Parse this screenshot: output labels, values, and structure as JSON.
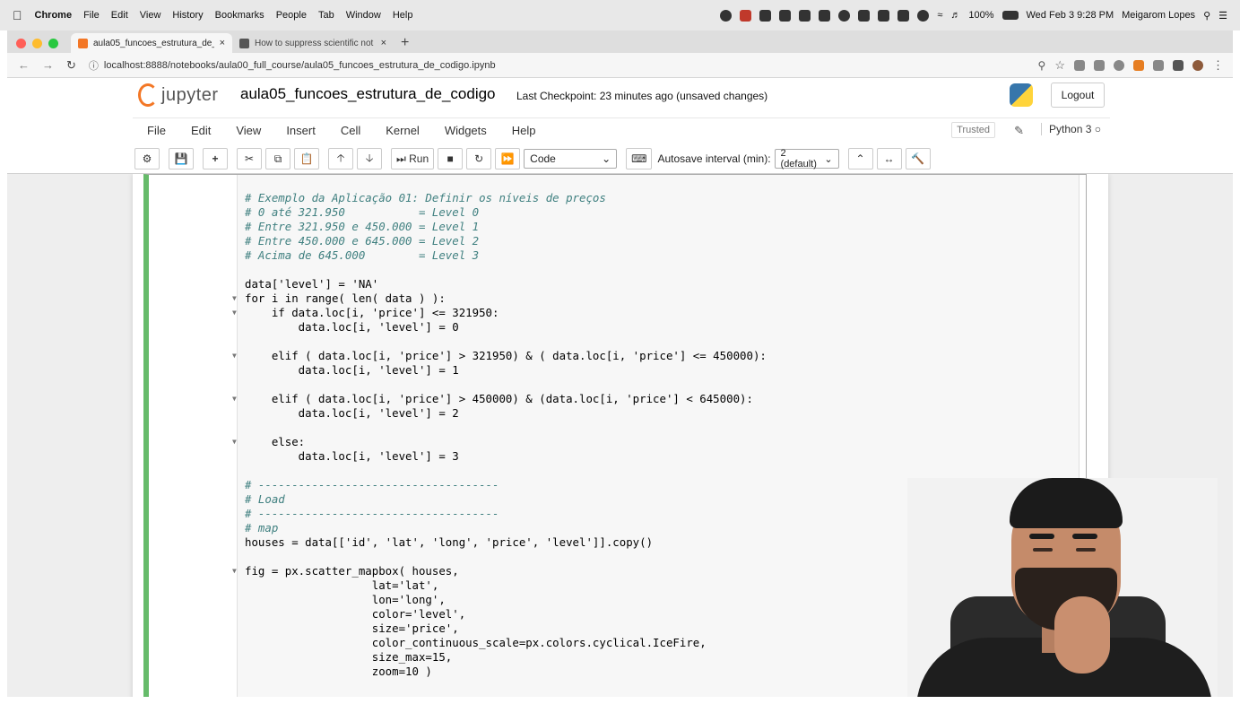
{
  "menubar": {
    "apple": "",
    "app": "Chrome",
    "items": [
      "File",
      "Edit",
      "View",
      "History",
      "Bookmarks",
      "People",
      "Tab",
      "Window",
      "Help"
    ],
    "battery": "100%",
    "datetime": "Wed Feb 3  9:28 PM",
    "user": "Meigarom Lopes"
  },
  "tabs": [
    {
      "title": "aula05_funcoes_estrutura_de_c",
      "close": "×",
      "active": true
    },
    {
      "title": "How to suppress scientific not",
      "close": "×",
      "active": false
    }
  ],
  "newtab": "+",
  "address": {
    "url": "localhost:8888/notebooks/aula00_full_course/aula05_funcoes_estrutura_de_codigo.ipynb"
  },
  "jupyter": {
    "logo": "jupyter",
    "notebook_name": "aula05_funcoes_estrutura_de_codigo",
    "checkpoint": "Last Checkpoint: 23 minutes ago  (unsaved changes)",
    "logout": "Logout",
    "menu": [
      "File",
      "Edit",
      "View",
      "Insert",
      "Cell",
      "Kernel",
      "Widgets",
      "Help"
    ],
    "trusted": "Trusted",
    "kernel": "Python 3",
    "toolbar": {
      "run": "Run",
      "cell_type": "Code",
      "autosave_label": "Autosave interval (min):",
      "autosave_value": "2 (default)"
    }
  },
  "code_lines": [
    "# Exemplo da Aplicação 01: Definir os níveis de preços",
    "# 0 até 321.950           = Level 0",
    "# Entre 321.950 e 450.000 = Level 1",
    "# Entre 450.000 e 645.000 = Level 2",
    "# Acima de 645.000        = Level 3",
    "data['level'] = 'NA'",
    "for i in range( len( data ) ):",
    "    if data.loc[i, 'price'] <= 321950:",
    "        data.loc[i, 'level'] = 0",
    "    elif ( data.loc[i, 'price'] > 321950) & ( data.loc[i, 'price'] <= 450000):",
    "        data.loc[i, 'level'] = 1",
    "    elif ( data.loc[i, 'price'] > 450000) & (data.loc[i, 'price'] < 645000):",
    "        data.loc[i, 'level'] = 2",
    "    else:",
    "        data.loc[i, 'level'] = 3",
    "# ------------------------------------",
    "# Load",
    "# ------------------------------------",
    "# map",
    "houses = data[['id', 'lat', 'long', 'price', 'level']].copy()",
    "fig = px.scatter_mapbox( houses,",
    "                   lat='lat',",
    "                   lon='long',",
    "                   color='level',",
    "                   size='price',",
    "                   color_continuous_scale=px.colors.cyclical.IceFire,",
    "                   size_max=15,",
    "                   zoom=10 )"
  ],
  "colors": {
    "cell_selected_border": "#66bb6a",
    "comment": "#408080",
    "string": "#ba2121",
    "keyword": "#008000",
    "jupyter_orange": "#f37726"
  }
}
